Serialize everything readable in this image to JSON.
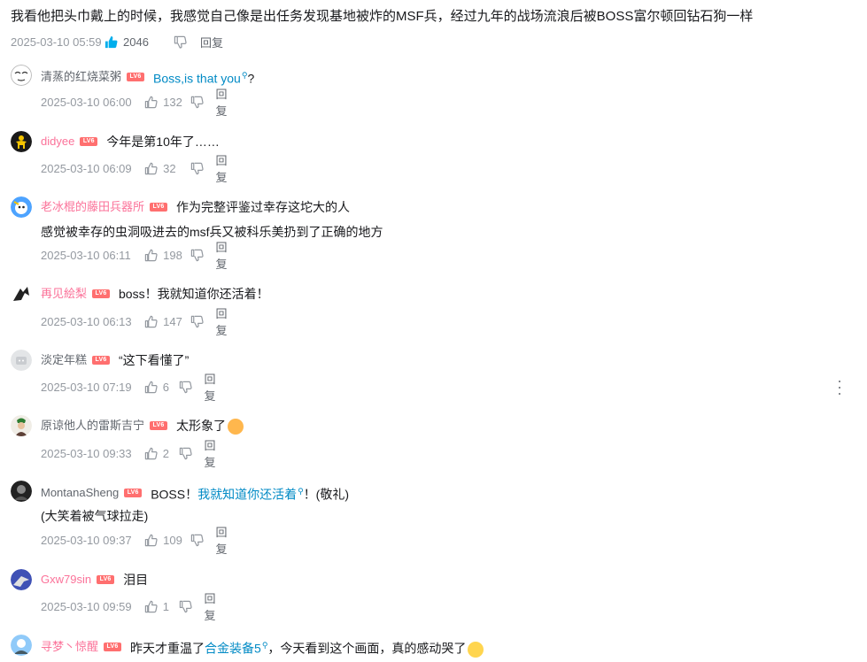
{
  "root": {
    "text": "我看他把头巾戴上的时候，我感觉自己像是出任务发现基地被炸的MSF兵，经过九年的战场流浪后被BOSS富尔顿回钻石狗一样",
    "time": "2025-03-10 05:59",
    "likes": "2046",
    "reply_label": "回复"
  },
  "level_badge": "LV6",
  "replies": [
    {
      "user": "清蒸的红烧菜粥",
      "user_color": "#61666d",
      "content_pre": "",
      "content_link": "Boss,is that you",
      "content_post": "?",
      "content2": "",
      "time": "2025-03-10 06:00",
      "likes": "132",
      "reply_label": "回复"
    },
    {
      "user": "didyee",
      "user_color": "#fb7299",
      "content_pre": "今年是第10年了……",
      "content_link": "",
      "content_post": "",
      "content2": "",
      "time": "2025-03-10 06:09",
      "likes": "32",
      "reply_label": "回复"
    },
    {
      "user": "老冰棍的藤田兵器所",
      "user_color": "#fb7299",
      "content_pre": "作为完整评鉴过幸存这坨大的人",
      "content_link": "",
      "content_post": "",
      "content2": "感觉被幸存的虫洞吸进去的msf兵又被科乐美扔到了正确的地方",
      "time": "2025-03-10 06:11",
      "likes": "198",
      "reply_label": "回复"
    },
    {
      "user": "再见絵梨",
      "user_color": "#fb7299",
      "content_pre": "boss！我就知道你还活着！",
      "content_link": "",
      "content_post": "",
      "content2": "",
      "time": "2025-03-10 06:13",
      "likes": "147",
      "reply_label": "回复"
    },
    {
      "user": "淡定年糕",
      "user_color": "#61666d",
      "content_pre": "“这下看懂了”",
      "content_link": "",
      "content_post": "",
      "content2": "",
      "time": "2025-03-10 07:19",
      "likes": "6",
      "reply_label": "回复"
    },
    {
      "user": "原谅他人的雷斯吉宁",
      "user_color": "#61666d",
      "content_pre": "太形象了",
      "content_link": "",
      "content_post": "",
      "content2": "",
      "time": "2025-03-10 09:33",
      "likes": "2",
      "reply_label": "回复"
    },
    {
      "user": "MontanaSheng",
      "user_color": "#61666d",
      "content_pre": "BOSS！",
      "content_link": "我就知道你还活着",
      "content_post": "！(敬礼)",
      "content2": "(大笑着被气球拉走)",
      "time": "2025-03-10 09:37",
      "likes": "109",
      "reply_label": "回复"
    },
    {
      "user": "Gxw79sin",
      "user_color": "#fb7299",
      "content_pre": "泪目",
      "content_link": "",
      "content_post": "",
      "content2": "",
      "time": "2025-03-10 09:59",
      "likes": "1",
      "reply_label": "回复"
    },
    {
      "user": "寻梦丶惊醒",
      "user_color": "#fb7299",
      "content_pre": "昨天才重温了",
      "content_link": "合金装备5",
      "content_post": "，今天看到这个画面，真的感动哭了",
      "content2": "",
      "time": "",
      "likes": "",
      "reply_label": ""
    }
  ],
  "colors": {
    "link": "#008ac5",
    "pink_name": "#fb7299",
    "gray_name": "#61666d",
    "meta": "#9499a0",
    "liked": "#00aeec"
  },
  "icons": [
    "thumb-up-icon",
    "thumb-down-icon",
    "search-icon",
    "more-icon"
  ]
}
